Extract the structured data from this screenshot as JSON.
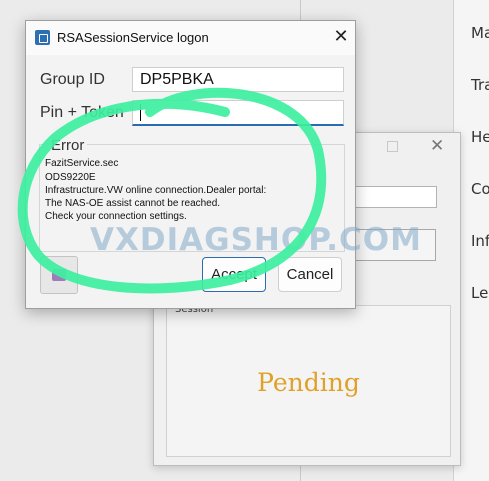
{
  "background": {
    "labels": [
      "Ma",
      "Tra",
      "He",
      "Co",
      "Inf",
      "Le"
    ]
  },
  "session_dialog": {
    "group_title": "Session",
    "status": "Pending"
  },
  "logon_dialog": {
    "title": "RSASessionService logon",
    "close_symbol": "✕",
    "group_id_label": "Group ID",
    "group_id_value": "DP5PBKA",
    "pin_token_label": "Pin + Token",
    "pin_token_value": "",
    "error_heading": "Error",
    "error_lines": [
      "FazitService.sec",
      "ODS9220E",
      "Infrastructure.VW online connection.Dealer portal:",
      "The NAS-OE assist cannot be reached.",
      "Check your connection settings."
    ],
    "accept_label": "Accept",
    "cancel_label": "Cancel"
  },
  "watermark": "VXDIAGSHOP.COM",
  "colors": {
    "scribble": "#3df0a0",
    "pending_text": "#e0a12a",
    "focus_accent": "#2b6cb0"
  }
}
